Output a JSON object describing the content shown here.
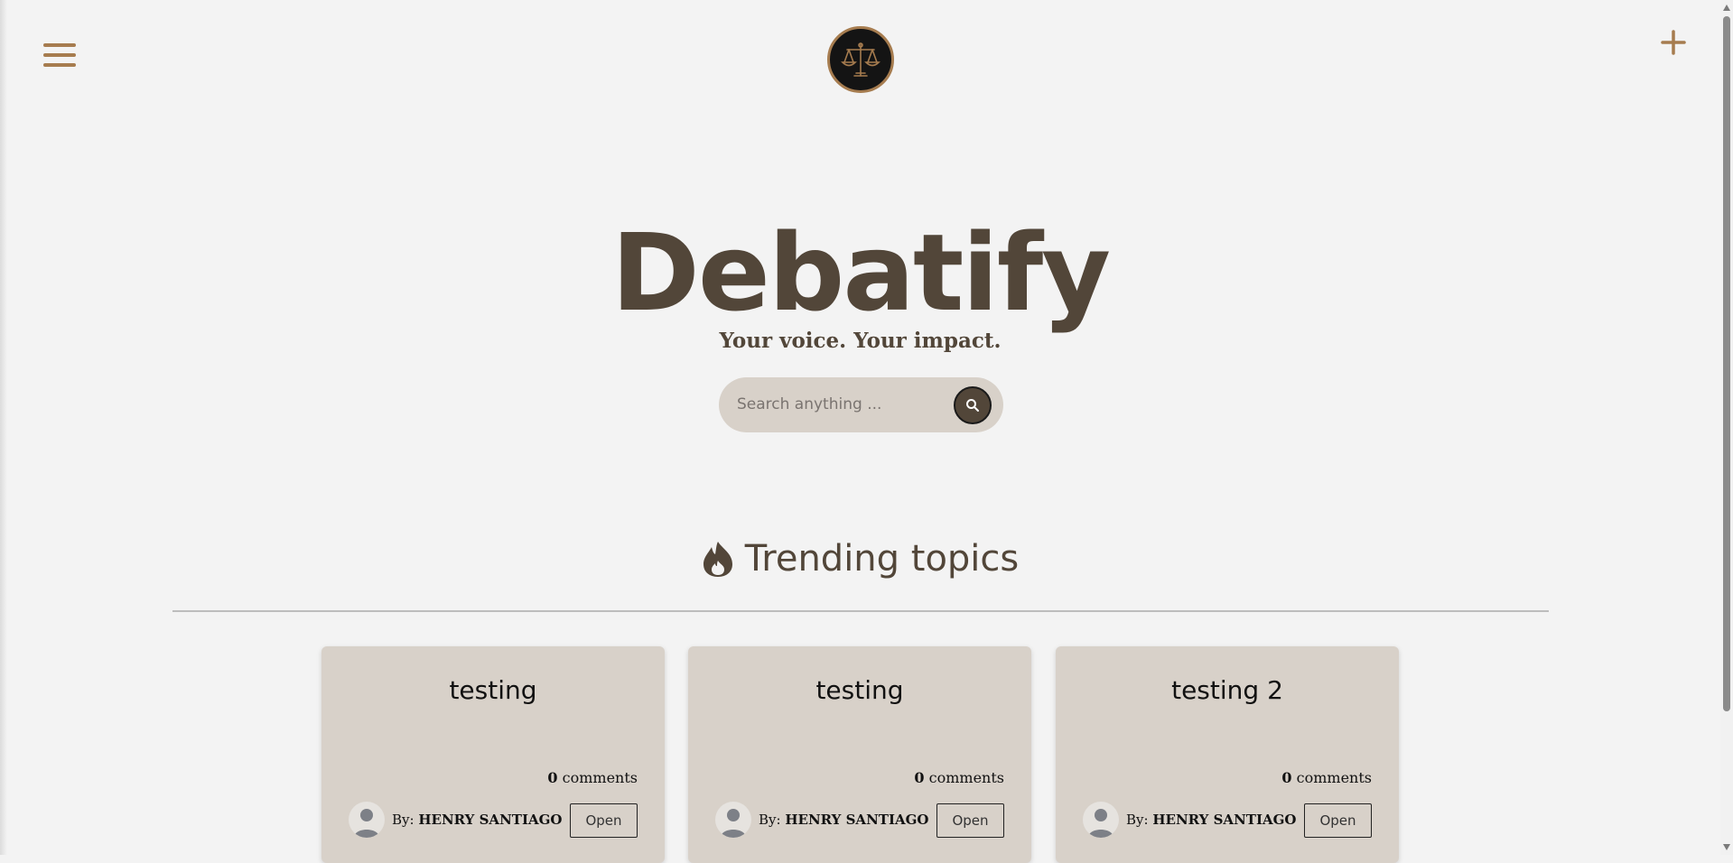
{
  "header": {
    "menu_icon": "hamburger-menu-icon",
    "logo_icon": "scales-of-justice-logo",
    "add_icon": "plus-icon"
  },
  "hero": {
    "title": "Debatify",
    "tagline": "Your voice. Your impact."
  },
  "search": {
    "placeholder": "Search anything ...",
    "button_icon": "search-icon"
  },
  "trending": {
    "icon": "flame-icon",
    "heading": "Trending topics",
    "cards": [
      {
        "title": "testing",
        "comment_count": "0",
        "comments_label": "comments",
        "by_label": "By:",
        "author": "HENRY SANTIAGO",
        "open_label": "Open"
      },
      {
        "title": "testing",
        "comment_count": "0",
        "comments_label": "comments",
        "by_label": "By:",
        "author": "HENRY SANTIAGO",
        "open_label": "Open"
      },
      {
        "title": "testing 2",
        "comment_count": "0",
        "comments_label": "comments",
        "by_label": "By:",
        "author": "HENRY SANTIAGO",
        "open_label": "Open"
      }
    ]
  },
  "colors": {
    "background": "#f3f3f3",
    "accent_gold": "#a67c4f",
    "brown_text": "#524639",
    "card_bg": "#d8d1c9"
  }
}
